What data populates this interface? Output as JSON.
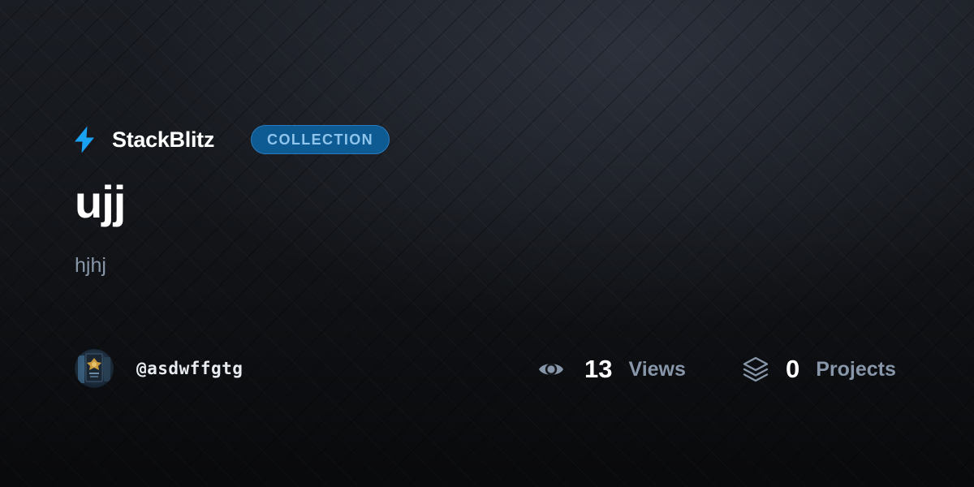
{
  "brand": {
    "name": "StackBlitz",
    "icon": "bolt-icon",
    "accent_color": "#1ba1f2"
  },
  "badge": {
    "label": "COLLECTION",
    "bg_color": "#0e5a92",
    "text_color": "#8fc5ec"
  },
  "collection": {
    "title": "ujj",
    "description": "hjhj"
  },
  "author": {
    "username": "@asdwffgtg",
    "avatar_icon": "avatar"
  },
  "stats": {
    "views": {
      "icon": "eye-icon",
      "value": "13",
      "label": "Views"
    },
    "projects": {
      "icon": "layers-icon",
      "value": "0",
      "label": "Projects"
    }
  },
  "colors": {
    "background": "#121418",
    "muted_text": "#8796a8"
  }
}
